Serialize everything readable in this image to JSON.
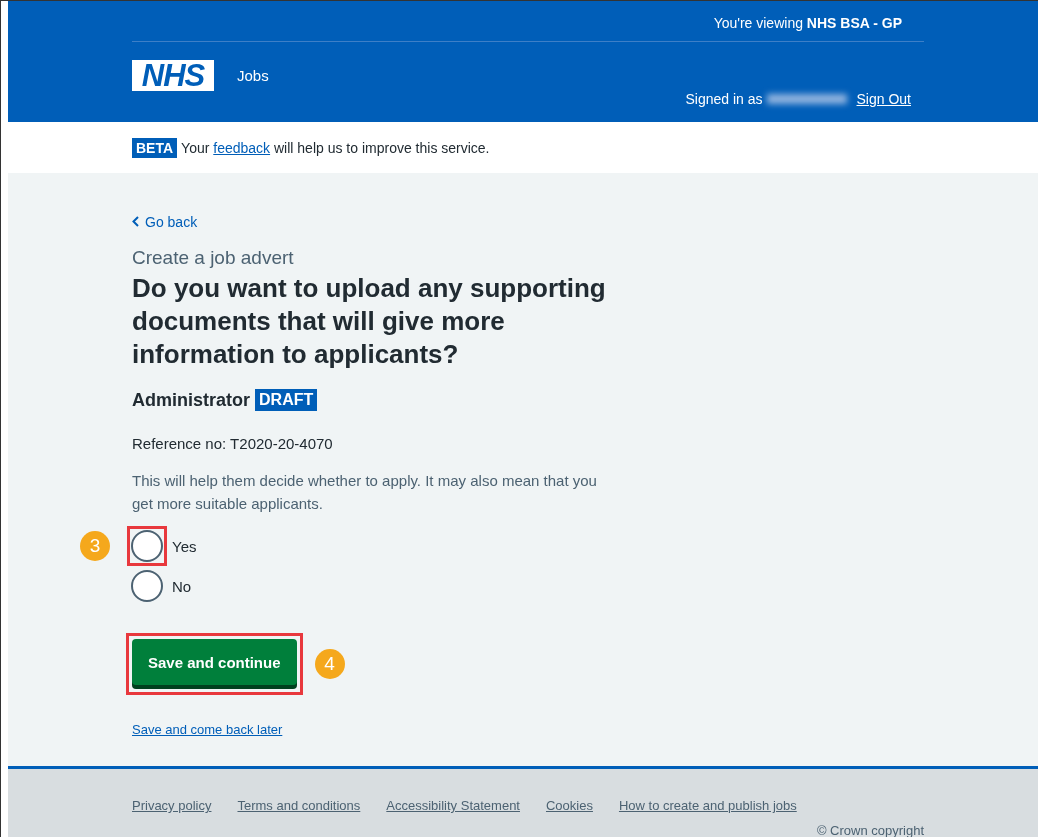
{
  "header": {
    "viewing_prefix": "You're viewing ",
    "organisation": "NHS BSA - GP",
    "logo": "NHS",
    "service": "Jobs",
    "signed_in_label": "Signed in as",
    "sign_out": "Sign Out"
  },
  "beta_banner": {
    "tag": "BETA",
    "text_before": "Your ",
    "link": "feedback",
    "text_after": " will help us to improve this service."
  },
  "back_link": "Go back",
  "caption": "Create a job advert",
  "heading": "Do you want to upload any supporting documents that will give more information to applicants?",
  "job_title": "Administrator",
  "status_tag": "DRAFT",
  "reference": "Reference no: T2020-20-4070",
  "hint": "This will help them decide whether to apply. It may also mean that you get more suitable applicants.",
  "options": [
    {
      "label": "Yes",
      "selected": false,
      "highlighted": true,
      "callout": "3"
    },
    {
      "label": "No",
      "selected": false,
      "highlighted": false
    }
  ],
  "primary_button": {
    "label": "Save and continue",
    "highlighted": true,
    "callout": "4"
  },
  "secondary_link": "Save and come back later",
  "footer": {
    "links": [
      "Privacy policy",
      "Terms and conditions",
      "Accessibility Statement",
      "Cookies",
      "How to create and publish jobs"
    ],
    "copyright": "© Crown copyright"
  }
}
